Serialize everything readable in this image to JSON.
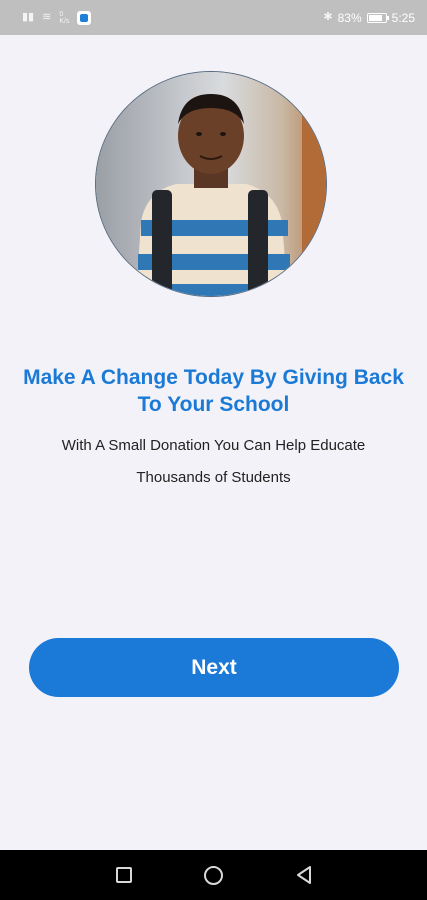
{
  "status_bar": {
    "signal_left": "▐▐",
    "net_speed": "0\nK/s",
    "battery_percent": "83%",
    "battery_level": 0.83,
    "time": "5:25",
    "bluetooth_icon": "ᛒ"
  },
  "hero": {
    "alt": "Smiling student with backpack"
  },
  "content": {
    "headline": "Make A Change Today By Giving Back To Your School",
    "subtext": "With A Small Donation You Can Help Educate Thousands of Students"
  },
  "button": {
    "label": "Next"
  },
  "colors": {
    "accent": "#1b7ad8",
    "background": "#f3f2f8",
    "status_bar": "#bfbfbf",
    "nav_bar": "#000000"
  },
  "nav": {
    "recents_icon": "square-icon",
    "home_icon": "circle-icon",
    "back_icon": "triangle-back-icon"
  }
}
